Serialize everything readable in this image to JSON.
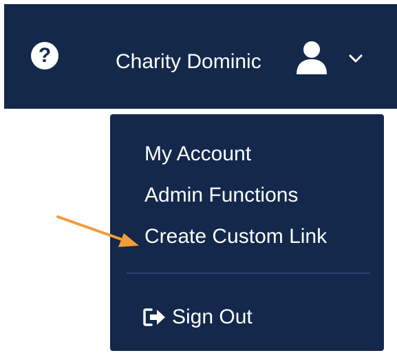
{
  "header": {
    "help_glyph": "?",
    "user_name": "Charity Dominic",
    "icons": {
      "help": "question-circle-icon",
      "avatar": "user-icon",
      "dropdown": "chevron-down-icon"
    }
  },
  "menu": {
    "my_account": "My Account",
    "admin_functions": "Admin Functions",
    "create_custom_link": "Create Custom Link",
    "sign_out": "Sign Out",
    "sign_out_icon": "sign-out-icon"
  },
  "colors": {
    "header_bg": "#14284a",
    "menu_bg": "#13284b",
    "text": "#ffffff",
    "arrow": "#f39c3a"
  }
}
